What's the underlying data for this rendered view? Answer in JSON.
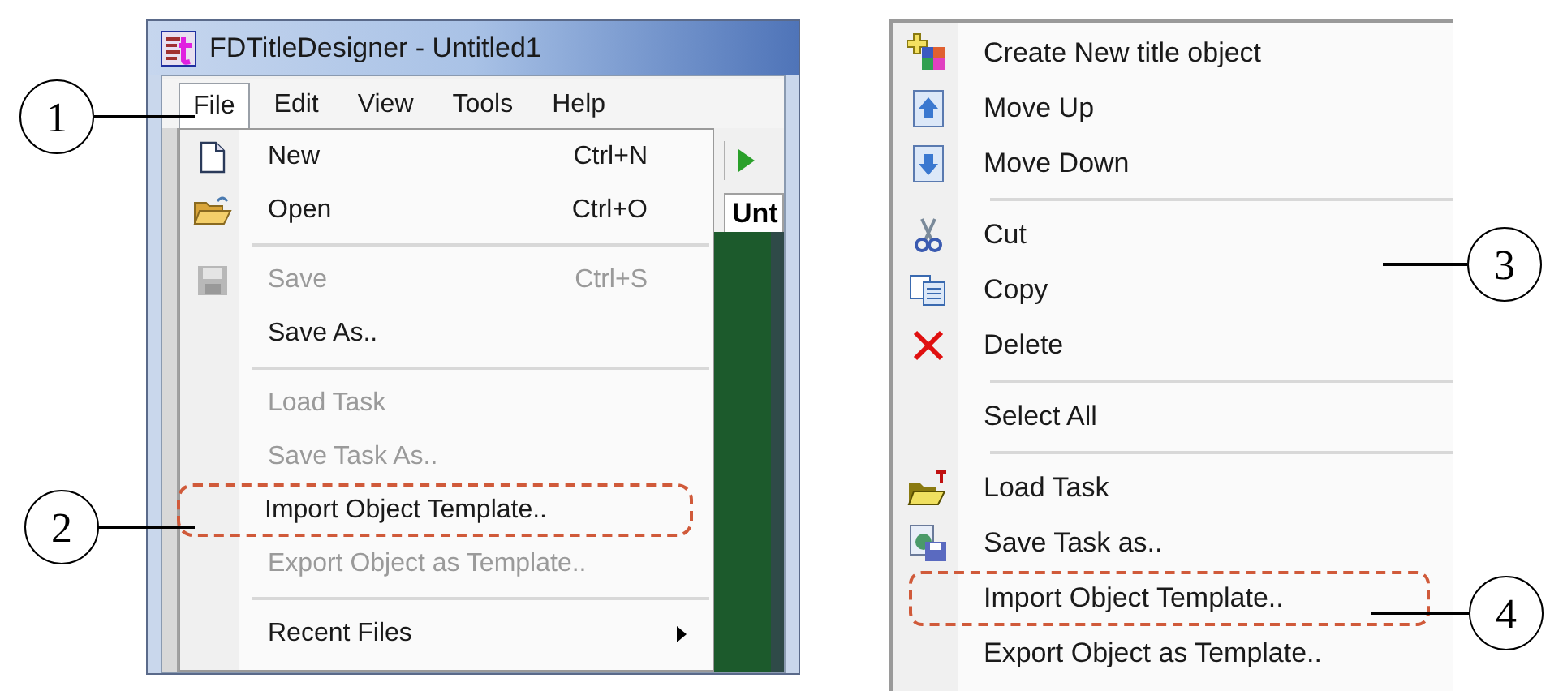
{
  "left_window": {
    "title": "FDTitleDesigner - Untitled1",
    "menubar": [
      {
        "label": "File",
        "selected": true
      },
      {
        "label": "Edit",
        "selected": false
      },
      {
        "label": "View",
        "selected": false
      },
      {
        "label": "Tools",
        "selected": false
      },
      {
        "label": "Help",
        "selected": false
      }
    ],
    "file_menu": [
      {
        "kind": "item",
        "label": "New",
        "shortcut": "Ctrl+N",
        "disabled": false,
        "outlined": false,
        "submenu": false
      },
      {
        "kind": "item",
        "label": "Open",
        "shortcut": "Ctrl+O",
        "disabled": false,
        "outlined": false,
        "submenu": false
      },
      {
        "kind": "separator"
      },
      {
        "kind": "item",
        "label": "Save",
        "shortcut": "Ctrl+S",
        "disabled": true,
        "outlined": false,
        "submenu": false
      },
      {
        "kind": "item",
        "label": "Save As..",
        "disabled": false,
        "outlined": false,
        "submenu": false
      },
      {
        "kind": "separator"
      },
      {
        "kind": "item",
        "label": "Load Task",
        "disabled": true,
        "outlined": false,
        "submenu": false
      },
      {
        "kind": "item",
        "label": "Save Task As..",
        "disabled": true,
        "outlined": false,
        "submenu": false
      },
      {
        "kind": "item",
        "label": "Import Object Template..",
        "disabled": false,
        "outlined": true,
        "submenu": false
      },
      {
        "kind": "item",
        "label": "Export Object as Template..",
        "disabled": true,
        "outlined": false,
        "submenu": false
      },
      {
        "kind": "separator"
      },
      {
        "kind": "item",
        "label": "Recent Files",
        "disabled": false,
        "outlined": false,
        "submenu": true
      }
    ],
    "tab_label": "Unt"
  },
  "context_menu": [
    {
      "kind": "item",
      "label": "Create New title object",
      "outlined": false
    },
    {
      "kind": "item",
      "label": "Move Up",
      "outlined": false
    },
    {
      "kind": "item",
      "label": "Move Down",
      "outlined": false
    },
    {
      "kind": "separator"
    },
    {
      "kind": "item",
      "label": "Cut",
      "outlined": false
    },
    {
      "kind": "item",
      "label": "Copy",
      "outlined": false
    },
    {
      "kind": "item",
      "label": "Delete",
      "outlined": false
    },
    {
      "kind": "separator"
    },
    {
      "kind": "item",
      "label": "Select All",
      "outlined": false
    },
    {
      "kind": "separator"
    },
    {
      "kind": "item",
      "label": "Load Task",
      "outlined": false
    },
    {
      "kind": "item",
      "label": "Save Task as..",
      "outlined": false
    },
    {
      "kind": "item",
      "label": "Import Object Template..",
      "outlined": true
    },
    {
      "kind": "item",
      "label": "Export Object as Template..",
      "outlined": false
    }
  ],
  "callouts": [
    "1",
    "2",
    "3",
    "4"
  ]
}
